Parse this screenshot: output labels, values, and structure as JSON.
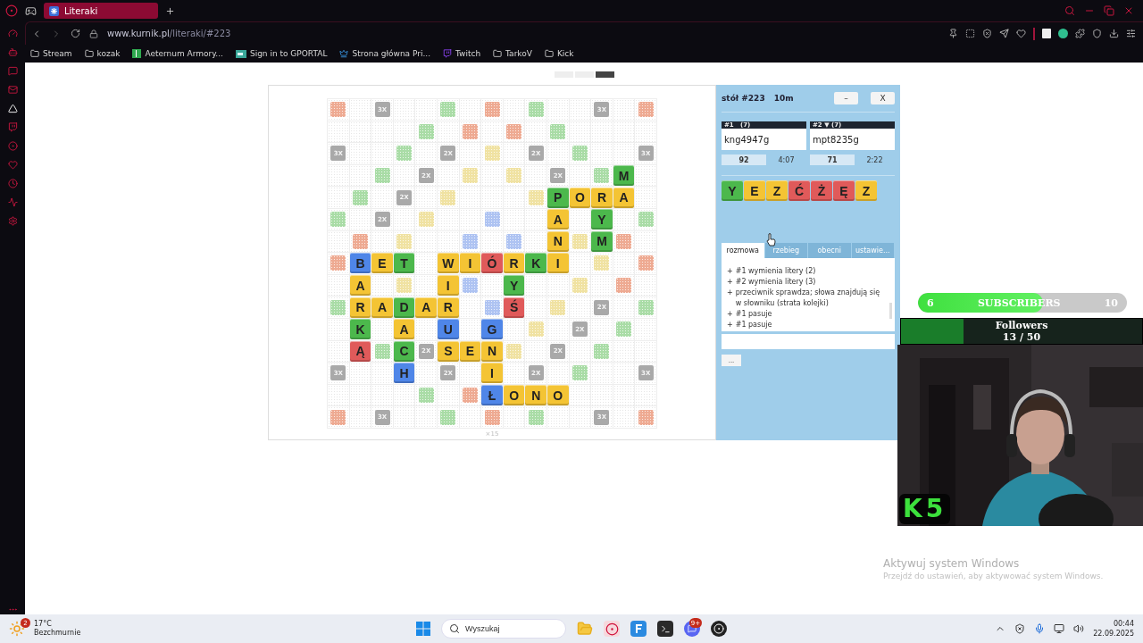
{
  "browser": {
    "tab": {
      "title": "Literaki"
    },
    "url": {
      "domain": "www.kurnik.pl",
      "path": "/literaki/#223"
    },
    "bookmarks": [
      {
        "label": "Stream",
        "kind": "folder"
      },
      {
        "label": "kozak",
        "kind": "folder"
      },
      {
        "label": "Aeternum Armory...",
        "kind": "sheet"
      },
      {
        "label": "Sign in to GPORTAL",
        "kind": "portal"
      },
      {
        "label": "Strona główna Pri...",
        "kind": "crown"
      },
      {
        "label": "Twitch",
        "kind": "twitch"
      },
      {
        "label": "TarkoV",
        "kind": "folder"
      },
      {
        "label": "Kick",
        "kind": "folder"
      }
    ]
  },
  "board": {
    "rows": [
      [
        {
          "kind": "pattern",
          "color": "#eeaa92"
        },
        {
          "kind": "empty"
        },
        {
          "kind": "bonus",
          "text": "3X"
        },
        {
          "kind": "empty"
        },
        {
          "kind": "empty"
        },
        {
          "kind": "pattern",
          "color": "#a9dca6"
        },
        {
          "kind": "empty"
        },
        {
          "kind": "pattern",
          "color": "#eeaa92"
        },
        {
          "kind": "empty"
        },
        {
          "kind": "pattern",
          "color": "#a9dca6"
        },
        {
          "kind": "empty"
        },
        {
          "kind": "empty"
        },
        {
          "kind": "bonus",
          "text": "3X"
        },
        {
          "kind": "empty"
        },
        {
          "kind": "pattern",
          "color": "#eeaa92"
        }
      ],
      [
        {
          "kind": "empty"
        },
        {
          "kind": "empty"
        },
        {
          "kind": "empty"
        },
        {
          "kind": "empty"
        },
        {
          "kind": "pattern",
          "color": "#a9dca6"
        },
        {
          "kind": "empty"
        },
        {
          "kind": "pattern",
          "color": "#eeaa92"
        },
        {
          "kind": "empty"
        },
        {
          "kind": "pattern",
          "color": "#eeaa92"
        },
        {
          "kind": "empty"
        },
        {
          "kind": "pattern",
          "color": "#a9dca6"
        },
        {
          "kind": "empty"
        },
        {
          "kind": "empty"
        },
        {
          "kind": "empty"
        },
        {
          "kind": "empty"
        }
      ],
      [
        {
          "kind": "bonus",
          "text": "3X"
        },
        {
          "kind": "empty"
        },
        {
          "kind": "empty"
        },
        {
          "kind": "pattern",
          "color": "#a9dca6"
        },
        {
          "kind": "empty"
        },
        {
          "kind": "bonus",
          "text": "2X"
        },
        {
          "kind": "empty"
        },
        {
          "kind": "pattern",
          "color": "#f0e2a2"
        },
        {
          "kind": "empty"
        },
        {
          "kind": "bonus",
          "text": "2X"
        },
        {
          "kind": "empty"
        },
        {
          "kind": "pattern",
          "color": "#a9dca6"
        },
        {
          "kind": "empty"
        },
        {
          "kind": "empty"
        },
        {
          "kind": "bonus",
          "text": "3X"
        }
      ],
      [
        {
          "kind": "empty"
        },
        {
          "kind": "empty"
        },
        {
          "kind": "pattern",
          "color": "#a9dca6"
        },
        {
          "kind": "empty"
        },
        {
          "kind": "bonus",
          "text": "2X"
        },
        {
          "kind": "empty"
        },
        {
          "kind": "pattern",
          "color": "#f0e2a2"
        },
        {
          "kind": "empty"
        },
        {
          "kind": "pattern",
          "color": "#f0e2a2"
        },
        {
          "kind": "empty"
        },
        {
          "kind": "bonus",
          "text": "2X"
        },
        {
          "kind": "empty"
        },
        {
          "kind": "pattern",
          "color": "#a9dca6"
        },
        {
          "kind": "tile",
          "text": "M",
          "color": "#4cb84c"
        },
        {
          "kind": "empty"
        }
      ],
      [
        {
          "kind": "empty"
        },
        {
          "kind": "pattern",
          "color": "#a9dca6"
        },
        {
          "kind": "empty"
        },
        {
          "kind": "bonus",
          "text": "2X"
        },
        {
          "kind": "empty"
        },
        {
          "kind": "pattern",
          "color": "#f0e2a2"
        },
        {
          "kind": "empty"
        },
        {
          "kind": "empty"
        },
        {
          "kind": "empty"
        },
        {
          "kind": "pattern",
          "color": "#f0e2a2"
        },
        {
          "kind": "tile",
          "text": "P",
          "color": "#4cb84c"
        },
        {
          "kind": "tile",
          "text": "O",
          "color": "#f4c434"
        },
        {
          "kind": "tile",
          "text": "R",
          "color": "#f4c434"
        },
        {
          "kind": "tile",
          "text": "A",
          "color": "#f4c434"
        },
        {
          "kind": "empty"
        }
      ],
      [
        {
          "kind": "pattern",
          "color": "#a9dca6"
        },
        {
          "kind": "empty"
        },
        {
          "kind": "bonus",
          "text": "2X"
        },
        {
          "kind": "empty"
        },
        {
          "kind": "pattern",
          "color": "#f0e2a2"
        },
        {
          "kind": "empty"
        },
        {
          "kind": "empty"
        },
        {
          "kind": "pattern",
          "color": "#aec3f2"
        },
        {
          "kind": "empty"
        },
        {
          "kind": "empty"
        },
        {
          "kind": "tile",
          "text": "A",
          "color": "#f4c434"
        },
        {
          "kind": "empty"
        },
        {
          "kind": "tile",
          "text": "Y",
          "color": "#4cb84c"
        },
        {
          "kind": "empty"
        },
        {
          "kind": "pattern",
          "color": "#a9dca6"
        }
      ],
      [
        {
          "kind": "empty"
        },
        {
          "kind": "pattern",
          "color": "#eeaa92"
        },
        {
          "kind": "empty"
        },
        {
          "kind": "pattern",
          "color": "#f0e2a2"
        },
        {
          "kind": "empty"
        },
        {
          "kind": "empty"
        },
        {
          "kind": "pattern",
          "color": "#aec3f2"
        },
        {
          "kind": "empty"
        },
        {
          "kind": "pattern",
          "color": "#aec3f2"
        },
        {
          "kind": "empty"
        },
        {
          "kind": "tile",
          "text": "N",
          "color": "#f4c434"
        },
        {
          "kind": "pattern",
          "color": "#f0e2a2"
        },
        {
          "kind": "tile",
          "text": "M",
          "color": "#4cb84c"
        },
        {
          "kind": "pattern",
          "color": "#eeaa92"
        },
        {
          "kind": "empty"
        }
      ],
      [
        {
          "kind": "pattern",
          "color": "#eeaa92"
        },
        {
          "kind": "tile",
          "text": "B",
          "color": "#4f86e8"
        },
        {
          "kind": "tile",
          "text": "E",
          "color": "#f4c434"
        },
        {
          "kind": "tile",
          "text": "T",
          "color": "#4cb84c"
        },
        {
          "kind": "empty"
        },
        {
          "kind": "tile",
          "text": "W",
          "color": "#f4c434"
        },
        {
          "kind": "tile",
          "text": "I",
          "color": "#f4c434"
        },
        {
          "kind": "tile",
          "text": "Ó",
          "color": "#e05a5a"
        },
        {
          "kind": "tile",
          "text": "R",
          "color": "#f4c434"
        },
        {
          "kind": "tile",
          "text": "K",
          "color": "#4cb84c"
        },
        {
          "kind": "tile",
          "text": "I",
          "color": "#f4c434"
        },
        {
          "kind": "empty"
        },
        {
          "kind": "pattern",
          "color": "#f0e2a2"
        },
        {
          "kind": "empty"
        },
        {
          "kind": "pattern",
          "color": "#eeaa92"
        }
      ],
      [
        {
          "kind": "empty"
        },
        {
          "kind": "tile",
          "text": "A",
          "color": "#f4c434"
        },
        {
          "kind": "empty"
        },
        {
          "kind": "pattern",
          "color": "#f0e2a2"
        },
        {
          "kind": "empty"
        },
        {
          "kind": "tile",
          "text": "I",
          "color": "#f4c434"
        },
        {
          "kind": "pattern",
          "color": "#aec3f2"
        },
        {
          "kind": "empty"
        },
        {
          "kind": "tile",
          "text": "Y",
          "color": "#4cb84c"
        },
        {
          "kind": "empty"
        },
        {
          "kind": "empty"
        },
        {
          "kind": "pattern",
          "color": "#f0e2a2"
        },
        {
          "kind": "empty"
        },
        {
          "kind": "pattern",
          "color": "#eeaa92"
        },
        {
          "kind": "empty"
        }
      ],
      [
        {
          "kind": "pattern",
          "color": "#a9dca6"
        },
        {
          "kind": "tile",
          "text": "R",
          "color": "#f4c434"
        },
        {
          "kind": "tile",
          "text": "A",
          "color": "#f4c434"
        },
        {
          "kind": "tile",
          "text": "D",
          "color": "#4cb84c"
        },
        {
          "kind": "tile",
          "text": "A",
          "color": "#f4c434"
        },
        {
          "kind": "tile",
          "text": "R",
          "color": "#f4c434"
        },
        {
          "kind": "empty"
        },
        {
          "kind": "pattern",
          "color": "#aec3f2"
        },
        {
          "kind": "tile",
          "text": "Ś",
          "color": "#e05a5a"
        },
        {
          "kind": "empty"
        },
        {
          "kind": "pattern",
          "color": "#f0e2a2"
        },
        {
          "kind": "empty"
        },
        {
          "kind": "bonus",
          "text": "2X"
        },
        {
          "kind": "empty"
        },
        {
          "kind": "pattern",
          "color": "#a9dca6"
        }
      ],
      [
        {
          "kind": "empty"
        },
        {
          "kind": "tile",
          "text": "K",
          "color": "#4cb84c"
        },
        {
          "kind": "empty"
        },
        {
          "kind": "tile",
          "text": "A",
          "color": "#f4c434"
        },
        {
          "kind": "empty"
        },
        {
          "kind": "tile",
          "text": "U",
          "color": "#4f86e8"
        },
        {
          "kind": "empty"
        },
        {
          "kind": "tile",
          "text": "G",
          "color": "#4f86e8"
        },
        {
          "kind": "empty"
        },
        {
          "kind": "pattern",
          "color": "#f0e2a2"
        },
        {
          "kind": "empty"
        },
        {
          "kind": "bonus",
          "text": "2X"
        },
        {
          "kind": "empty"
        },
        {
          "kind": "pattern",
          "color": "#a9dca6"
        },
        {
          "kind": "empty"
        }
      ],
      [
        {
          "kind": "empty"
        },
        {
          "kind": "tile",
          "text": "Ą",
          "color": "#e05a5a"
        },
        {
          "kind": "pattern",
          "color": "#a9dca6"
        },
        {
          "kind": "tile",
          "text": "C",
          "color": "#4cb84c"
        },
        {
          "kind": "bonus",
          "text": "2X"
        },
        {
          "kind": "tile",
          "text": "S",
          "color": "#f4c434"
        },
        {
          "kind": "tile",
          "text": "E",
          "color": "#f4c434"
        },
        {
          "kind": "tile",
          "text": "N",
          "color": "#f4c434"
        },
        {
          "kind": "pattern",
          "color": "#f0e2a2"
        },
        {
          "kind": "empty"
        },
        {
          "kind": "bonus",
          "text": "2X"
        },
        {
          "kind": "empty"
        },
        {
          "kind": "pattern",
          "color": "#a9dca6"
        },
        {
          "kind": "empty"
        },
        {
          "kind": "empty"
        }
      ],
      [
        {
          "kind": "bonus",
          "text": "3X"
        },
        {
          "kind": "empty"
        },
        {
          "kind": "empty"
        },
        {
          "kind": "tile",
          "text": "H",
          "color": "#4f86e8"
        },
        {
          "kind": "empty"
        },
        {
          "kind": "bonus",
          "text": "2X"
        },
        {
          "kind": "empty"
        },
        {
          "kind": "tile",
          "text": "I",
          "color": "#f4c434"
        },
        {
          "kind": "empty"
        },
        {
          "kind": "bonus",
          "text": "2X"
        },
        {
          "kind": "empty"
        },
        {
          "kind": "pattern",
          "color": "#a9dca6"
        },
        {
          "kind": "empty"
        },
        {
          "kind": "empty"
        },
        {
          "kind": "bonus",
          "text": "3X"
        }
      ],
      [
        {
          "kind": "empty"
        },
        {
          "kind": "empty"
        },
        {
          "kind": "empty"
        },
        {
          "kind": "empty"
        },
        {
          "kind": "pattern",
          "color": "#a9dca6"
        },
        {
          "kind": "empty"
        },
        {
          "kind": "pattern",
          "color": "#eeaa92"
        },
        {
          "kind": "tile",
          "text": "Ł",
          "color": "#4f86e8"
        },
        {
          "kind": "tile",
          "text": "O",
          "color": "#f4c434"
        },
        {
          "kind": "tile",
          "text": "N",
          "color": "#f4c434"
        },
        {
          "kind": "tile",
          "text": "O",
          "color": "#f4c434"
        },
        {
          "kind": "empty"
        },
        {
          "kind": "empty"
        },
        {
          "kind": "empty"
        },
        {
          "kind": "empty"
        }
      ],
      [
        {
          "kind": "pattern",
          "color": "#eeaa92"
        },
        {
          "kind": "empty"
        },
        {
          "kind": "bonus",
          "text": "3X"
        },
        {
          "kind": "empty"
        },
        {
          "kind": "empty"
        },
        {
          "kind": "pattern",
          "color": "#a9dca6"
        },
        {
          "kind": "empty"
        },
        {
          "kind": "pattern",
          "color": "#eeaa92"
        },
        {
          "kind": "empty"
        },
        {
          "kind": "pattern",
          "color": "#a9dca6"
        },
        {
          "kind": "empty"
        },
        {
          "kind": "empty"
        },
        {
          "kind": "bonus",
          "text": "3X"
        },
        {
          "kind": "empty"
        },
        {
          "kind": "pattern",
          "color": "#eeaa92"
        }
      ]
    ],
    "size_label": "×15"
  },
  "panel": {
    "table": "stół #223",
    "time_control": "10m",
    "buttons": [
      "–",
      "X"
    ],
    "players": [
      {
        "header": "#1   (7)",
        "name": "kng4947g",
        "score": "92",
        "clock": "4:07"
      },
      {
        "header": "#2 ▼ (7)",
        "name": "mpt8235g",
        "score": "71",
        "clock": "2:22"
      }
    ],
    "rack": [
      {
        "text": "Y",
        "color": "#4cb84c"
      },
      {
        "text": "E",
        "color": "#f4c434"
      },
      {
        "text": "Z",
        "color": "#f4c434"
      },
      {
        "text": "Ć",
        "color": "#e05a5a"
      },
      {
        "text": "Ż",
        "color": "#e05a5a"
      },
      {
        "text": "Ę",
        "color": "#e05a5a"
      },
      {
        "text": "Z",
        "color": "#f4c434"
      }
    ],
    "tabs": [
      {
        "label": "rozmowa",
        "selected": true
      },
      {
        "label": "rzebieg",
        "selected": false
      },
      {
        "label": "obecni",
        "selected": false
      },
      {
        "label": "ustawie...",
        "selected": false
      }
    ],
    "log": [
      {
        "bullet": "+",
        "text": "#1 wymienia litery (2)"
      },
      {
        "bullet": "+",
        "text": "#2 wymienia litery (3)"
      },
      {
        "bullet": "+",
        "text": "przeciwnik sprawdza; słowa znajdują się w słowniku (strata kolejki)"
      },
      {
        "bullet": "+",
        "text": "#1 pasuje"
      },
      {
        "bullet": "+",
        "text": "#1 pasuje"
      }
    ],
    "more_button": "..."
  },
  "overlay": {
    "subscribers": {
      "current": "6",
      "label": "SUBSCRIBERS",
      "goal": "10",
      "level": 0.6
    },
    "followers": {
      "label": "Followers",
      "count": "13 / 50",
      "level": 0.26
    },
    "logo": "K5"
  },
  "activation": {
    "title": "Aktywuj system Windows",
    "text": "Przejdź do ustawień, aby aktywować system Windows."
  },
  "taskbar": {
    "temperature": "17°C",
    "weather": "Bezchmurnie",
    "weather_badge": "2",
    "search": {
      "placeholder": "Wyszukaj"
    },
    "discord_badge": "9+",
    "time": "00:44",
    "date": "22.09.2025"
  }
}
